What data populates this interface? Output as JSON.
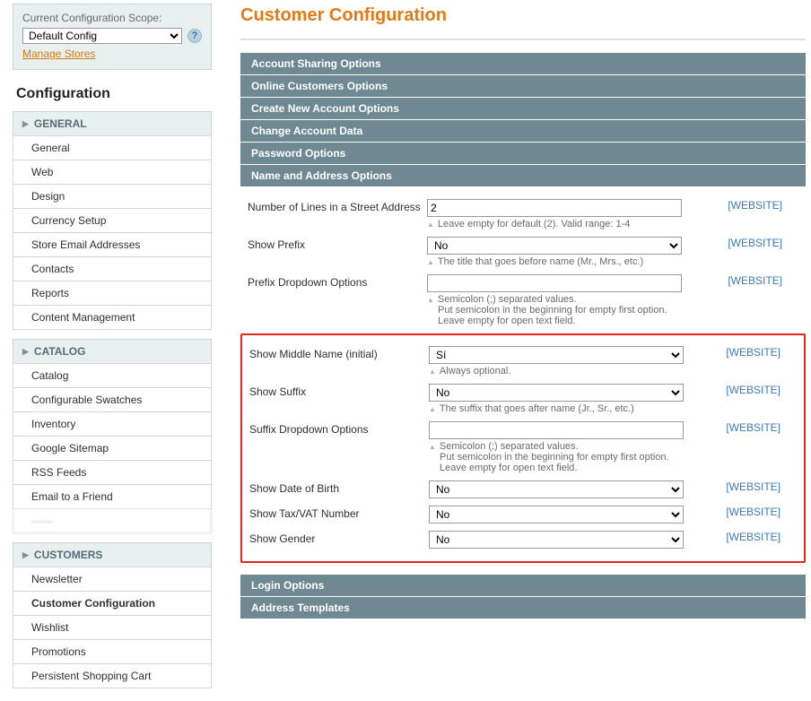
{
  "scope": {
    "label": "Current Configuration Scope:",
    "value": "Default Config",
    "manage_label": "Manage Stores"
  },
  "side_heading": "Configuration",
  "nav": {
    "general": {
      "head": "GENERAL",
      "items": [
        "General",
        "Web",
        "Design",
        "Currency Setup",
        "Store Email Addresses",
        "Contacts",
        "Reports",
        "Content Management"
      ]
    },
    "catalog": {
      "head": "CATALOG",
      "items": [
        "Catalog",
        "Configurable Swatches",
        "Inventory",
        "Google Sitemap",
        "RSS Feeds",
        "Email to a Friend"
      ]
    },
    "customers": {
      "head": "CUSTOMERS",
      "items": [
        "Newsletter",
        "Customer Configuration",
        "Wishlist",
        "Promotions",
        "Persistent Shopping Cart"
      ],
      "active_index": 1
    }
  },
  "page_title": "Customer Configuration",
  "scope_link": "[WEBSITE]",
  "sections": {
    "s1": "Account Sharing Options",
    "s2": "Online Customers Options",
    "s3": "Create New Account Options",
    "s4": "Change Account Data",
    "s5": "Password Options",
    "s6": "Name and Address Options",
    "s7": "Login Options",
    "s8": "Address Templates"
  },
  "fields": {
    "lines": {
      "label": "Number of Lines in a Street Address",
      "value": "2",
      "hint": "Leave empty for default (2). Valid range: 1-4"
    },
    "prefix": {
      "label": "Show Prefix",
      "value": "No",
      "hint": "The title that goes before name (Mr., Mrs., etc.)"
    },
    "prefix_opts": {
      "label": "Prefix Dropdown Options",
      "value": "",
      "hint1": "Semicolon (;) separated values.",
      "hint2": "Put semicolon in the beginning for empty first option.",
      "hint3": "Leave empty for open text field."
    },
    "middle": {
      "label": "Show Middle Name (initial)",
      "value": "Sí",
      "hint": "Always optional."
    },
    "suffix": {
      "label": "Show Suffix",
      "value": "No",
      "hint": "The suffix that goes after name (Jr., Sr., etc.)"
    },
    "suffix_opts": {
      "label": "Suffix Dropdown Options",
      "value": "",
      "hint1": "Semicolon (;) separated values.",
      "hint2": "Put semicolon in the beginning for empty first option.",
      "hint3": "Leave empty for open text field."
    },
    "dob": {
      "label": "Show Date of Birth",
      "value": "No"
    },
    "tax": {
      "label": "Show Tax/VAT Number",
      "value": "No"
    },
    "gender": {
      "label": "Show Gender",
      "value": "No"
    }
  }
}
